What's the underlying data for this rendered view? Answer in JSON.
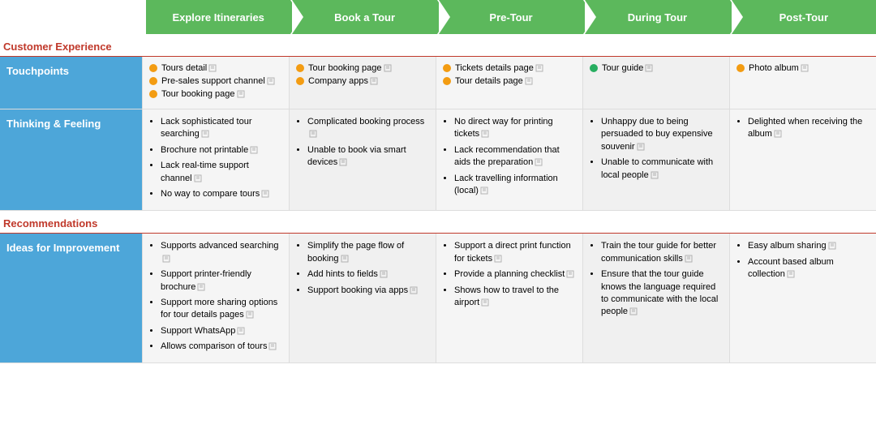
{
  "header": {
    "columns": [
      {
        "label": "Explore Itineraries"
      },
      {
        "label": "Book a Tour"
      },
      {
        "label": "Pre-Tour"
      },
      {
        "label": "During Tour"
      },
      {
        "label": "Post-Tour"
      }
    ]
  },
  "sections": {
    "customer_experience": {
      "label": "Customer Experience"
    },
    "recommendations": {
      "label": "Recommendations"
    }
  },
  "rows": {
    "touchpoints": {
      "header": "Touchpoints",
      "cells": [
        {
          "items": [
            {
              "color": "orange",
              "text": "Tours detail"
            },
            {
              "color": "orange",
              "text": "Pre-sales support channel"
            },
            {
              "color": "orange",
              "text": "Tour booking page"
            }
          ]
        },
        {
          "items": [
            {
              "color": "orange",
              "text": "Tour booking page"
            },
            {
              "color": "orange",
              "text": "Company apps"
            }
          ]
        },
        {
          "items": [
            {
              "color": "orange",
              "text": "Tickets details page"
            },
            {
              "color": "orange",
              "text": "Tour details page"
            }
          ]
        },
        {
          "items": [
            {
              "color": "green",
              "text": "Tour guide"
            }
          ]
        },
        {
          "items": [
            {
              "color": "orange",
              "text": "Photo album"
            }
          ]
        }
      ]
    },
    "thinking_feeling": {
      "header": "Thinking & Feeling",
      "cells": [
        {
          "bullets": [
            "Lack sophisticated tour searching",
            "Brochure not printable",
            "Lack real-time support channel",
            "No way to compare tours"
          ]
        },
        {
          "bullets": [
            "Complicated booking process",
            "Unable to book via smart devices"
          ]
        },
        {
          "bullets": [
            "No direct way for printing tickets",
            "Lack recommendation that aids the preparation",
            "Lack travelling information (local)"
          ]
        },
        {
          "bullets": [
            "Unhappy due to being persuaded to buy expensive souvenir",
            "Unable to communicate with local people"
          ]
        },
        {
          "bullets": [
            "Delighted when receiving the album"
          ]
        }
      ]
    },
    "ideas": {
      "header": "Ideas for Improvement",
      "cells": [
        {
          "bullets": [
            "Supports advanced searching",
            "Support printer-friendly brochure",
            "Support more sharing options for tour details pages",
            "Support WhatsApp",
            "Allows comparison of tours"
          ]
        },
        {
          "bullets": [
            "Simplify the page flow of booking",
            "Add hints to fields",
            "Support booking via apps"
          ]
        },
        {
          "bullets": [
            "Support a direct print function for tickets",
            "Provide a planning checklist",
            "Shows how to travel to the airport"
          ]
        },
        {
          "bullets": [
            "Train the tour guide for better communication skills",
            "Ensure that the tour guide knows the language required to communicate with the local people"
          ]
        },
        {
          "bullets": [
            "Easy album sharing",
            "Account based album collection"
          ]
        }
      ]
    }
  }
}
